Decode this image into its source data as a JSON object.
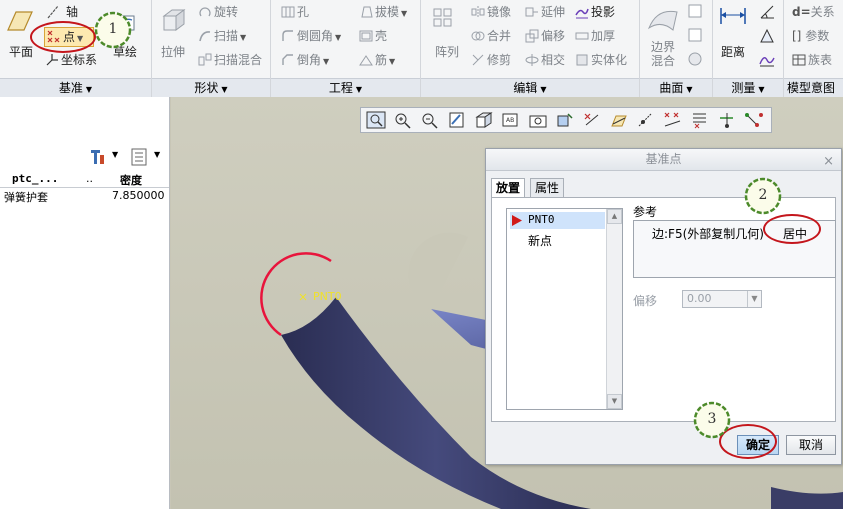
{
  "ribbon": {
    "datum": {
      "plane": "平面",
      "axis": "轴",
      "point": "点",
      "csys": "坐标系",
      "sketch": "草绘",
      "label": "基准"
    },
    "shapes": {
      "extrude": "拉伸",
      "revolve": "旋转",
      "sweep": "扫描",
      "swept_blend": "扫描混合",
      "label": "形状"
    },
    "engineering": {
      "hole": "孔",
      "round": "倒圆角",
      "chamfer": "倒角",
      "draft": "拔模",
      "shell": "壳",
      "rib": "筋",
      "label": "工程"
    },
    "editing": {
      "pattern": "阵列",
      "mirror": "镜像",
      "merge": "合并",
      "trim": "修剪",
      "extend": "延伸",
      "offset": "偏移",
      "intersect": "相交",
      "project": "投影",
      "thicken": "加厚",
      "solidify": "实体化",
      "label": "编辑"
    },
    "surfaces": {
      "boundary_blend": "边界混合",
      "label": "曲面"
    },
    "measure": {
      "distance": "距离",
      "label": "测量"
    },
    "model_intent": {
      "relations": "关系",
      "parameters": "参数",
      "family_table": "族表",
      "label": "模型意图"
    }
  },
  "left_panel": {
    "columns": [
      "ptc_...",
      "..",
      "密度"
    ],
    "rows": [
      {
        "name": "弹簧护套",
        "value": "7.850000"
      }
    ]
  },
  "viewport": {
    "point_label": "PNT0"
  },
  "dialog": {
    "title": "基准点",
    "close": "×",
    "tabs": [
      "放置",
      "属性"
    ],
    "points": [
      "PNT0",
      "新点"
    ],
    "reference_label": "参考",
    "reference_value": "边:F5(外部复制几何)",
    "reference_type": "居中",
    "offset_label": "偏移",
    "offset_value": "0.00",
    "ok": "确定",
    "cancel": "取消"
  },
  "callouts": [
    "1",
    "2",
    "3"
  ],
  "colors": {
    "callout_red": "#c4161c",
    "pipe": "#3a3d66",
    "edge_highlight": "#e8143c",
    "point_marker": "#f0e22a"
  }
}
